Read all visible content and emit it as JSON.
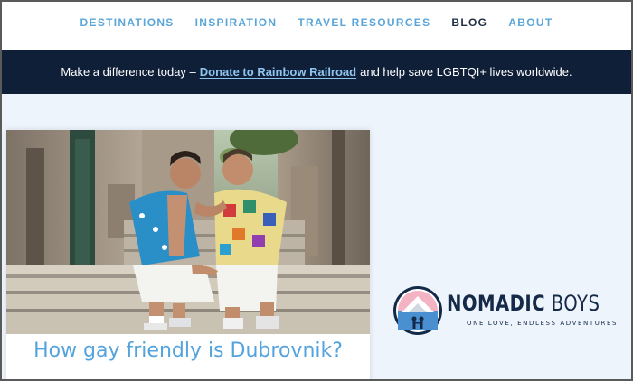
{
  "nav": {
    "items": [
      {
        "label": "DESTINATIONS",
        "active": false
      },
      {
        "label": "INSPIRATION",
        "active": false
      },
      {
        "label": "TRAVEL RESOURCES",
        "active": false
      },
      {
        "label": "BLOG",
        "active": true
      },
      {
        "label": "ABOUT",
        "active": false
      }
    ]
  },
  "banner": {
    "text_before": "Make a difference today –",
    "link_text": "Donate to Rainbow Railroad",
    "text_after": "and help save LGBTQI+ lives worldwide."
  },
  "article": {
    "title": "How gay friendly is Dubrovnik?",
    "image_icon": "photo-two-men-on-stone-steps"
  },
  "logo": {
    "name_part1": "NOMADIC",
    "name_part2": "BOYS",
    "tagline": "ONE LOVE, ENDLESS ADVENTURES"
  },
  "colors": {
    "nav_link": "#5aa6d9",
    "nav_active": "#1f2f44",
    "banner_bg": "#0f1f38",
    "donate_link": "#8ec5ef",
    "title": "#55a3dc",
    "sidebar_bg": "#eef4fc"
  }
}
